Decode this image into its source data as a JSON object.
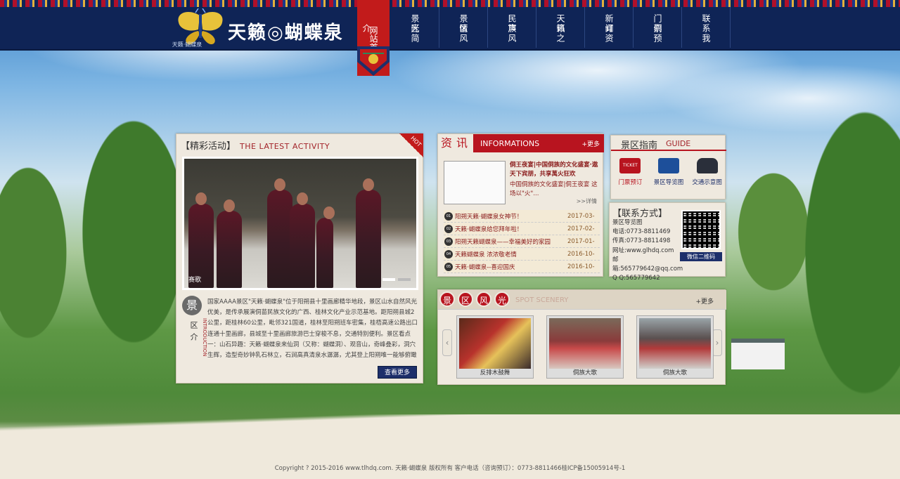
{
  "header": {
    "logo_name": "天籁◎蝴蝶泉",
    "logo_sub": "天籁·蝴蝶泉",
    "home_label": "网站首页",
    "nav": [
      "景区简介",
      "景区风光",
      "民族风情",
      "天籁之声",
      "新闻资讯",
      "门票预订",
      "联系我们"
    ]
  },
  "activity": {
    "title_cn": "【精彩活动】",
    "title_en": "THE LATEST ACTIVITY",
    "hot_badge": "HOT",
    "photo_caption": "赛歌",
    "intro_big": "景",
    "intro_small": "区介",
    "intro_en": "INTRODUCTION",
    "intro_text": "国家AAAA景区\"天籁·蝴蝶泉\"位于阳朔县十里画廊精华地段，景区山水自然风光优美，是传承展演侗苗民族文化的广西、桂林文化产业示范基地。距阳朔县城2公里，距桂林60公里，毗邻321国道，桂林至阳朔班车密集，桂梧高速公路出口连通十里画廊，县城至十里画廊旅游巴士穿梭不息，交通特别便利。景区看点一：山石异趣：天籁·蝴蝶泉来仙洞（又称：蝴蝶洞）、观音山，奇峰叠彩，洞穴生辉，造型奇妙钟乳石林立，石涧高真清泉水潺潺，尤其登上阳朔唯一能够俯瞰十里画廊全景的景天...",
    "more_button": "查看更多"
  },
  "info": {
    "seal": "资讯",
    "title_en": "INFORMATIONS",
    "more": "+更多",
    "lead_title": "侗王夜宴|中国侗族的文化盛宴·遨天下宾朋，共享萬火狂欢",
    "lead_desc": "中国侗族的文化盛宴|侗王夜宴 这场以\"火\"...",
    "lead_more": ">>详情",
    "items": [
      {
        "idx": "01",
        "title": "阳朔天籁·蝴蝶泉女神节！",
        "date": "2017-03-"
      },
      {
        "idx": "02",
        "title": "天籁·蝴蝶泉给您拜年啦！",
        "date": "2017-02-"
      },
      {
        "idx": "03",
        "title": "阳朔天籁蝴蝶泉——幸福美好的家园",
        "date": "2017-01-"
      },
      {
        "idx": "04",
        "title": "天籁蝴蝶泉 浓浓敬老情",
        "date": "2016-10-"
      },
      {
        "idx": "05",
        "title": "天籁·蝴蝶泉--喜迎国庆",
        "date": "2016-10-"
      }
    ]
  },
  "guide": {
    "title_cn": "景区指南",
    "title_en": "GUIDE",
    "items": [
      {
        "label": "门票预订",
        "icon": "ticket-icon",
        "icon_text": "TICKET"
      },
      {
        "label": "景区导览图",
        "icon": "map-icon",
        "icon_text": ""
      },
      {
        "label": "交通示意图",
        "icon": "car-icon",
        "icon_text": ""
      }
    ]
  },
  "contact": {
    "title": "【联系方式】",
    "lines": [
      "景区导览图",
      "电话:0773-8811469",
      "传真:0773-8811498",
      "网址:www.glhdq.com",
      "邮箱:565779642@qq.com",
      "Q Q:565779642"
    ],
    "qr_label": "微信二维码"
  },
  "scenery": {
    "seals": [
      "景",
      "区",
      "风",
      "光"
    ],
    "title_en": "SPOT SCENERY",
    "more": "+更多",
    "items": [
      {
        "caption": "反排木鼓舞",
        "color": "#b8322c"
      },
      {
        "caption": "侗族大歌",
        "color": "#8a3b3b"
      },
      {
        "caption": "侗族大歌",
        "color": "#6d6a6a"
      }
    ],
    "prev": "‹",
    "next": "›"
  },
  "footer": {
    "text": "Copyright ? 2015-2016 www.tlhdq.com. 天籁·蝴蝶泉 版权所有 客户电话（咨询预订）：0773-8811466桂ICP备15005914号-1"
  },
  "colors": {
    "header_bg": "#0f2456",
    "accent_red": "#b8141f",
    "panel_bg": "#efe9df"
  }
}
